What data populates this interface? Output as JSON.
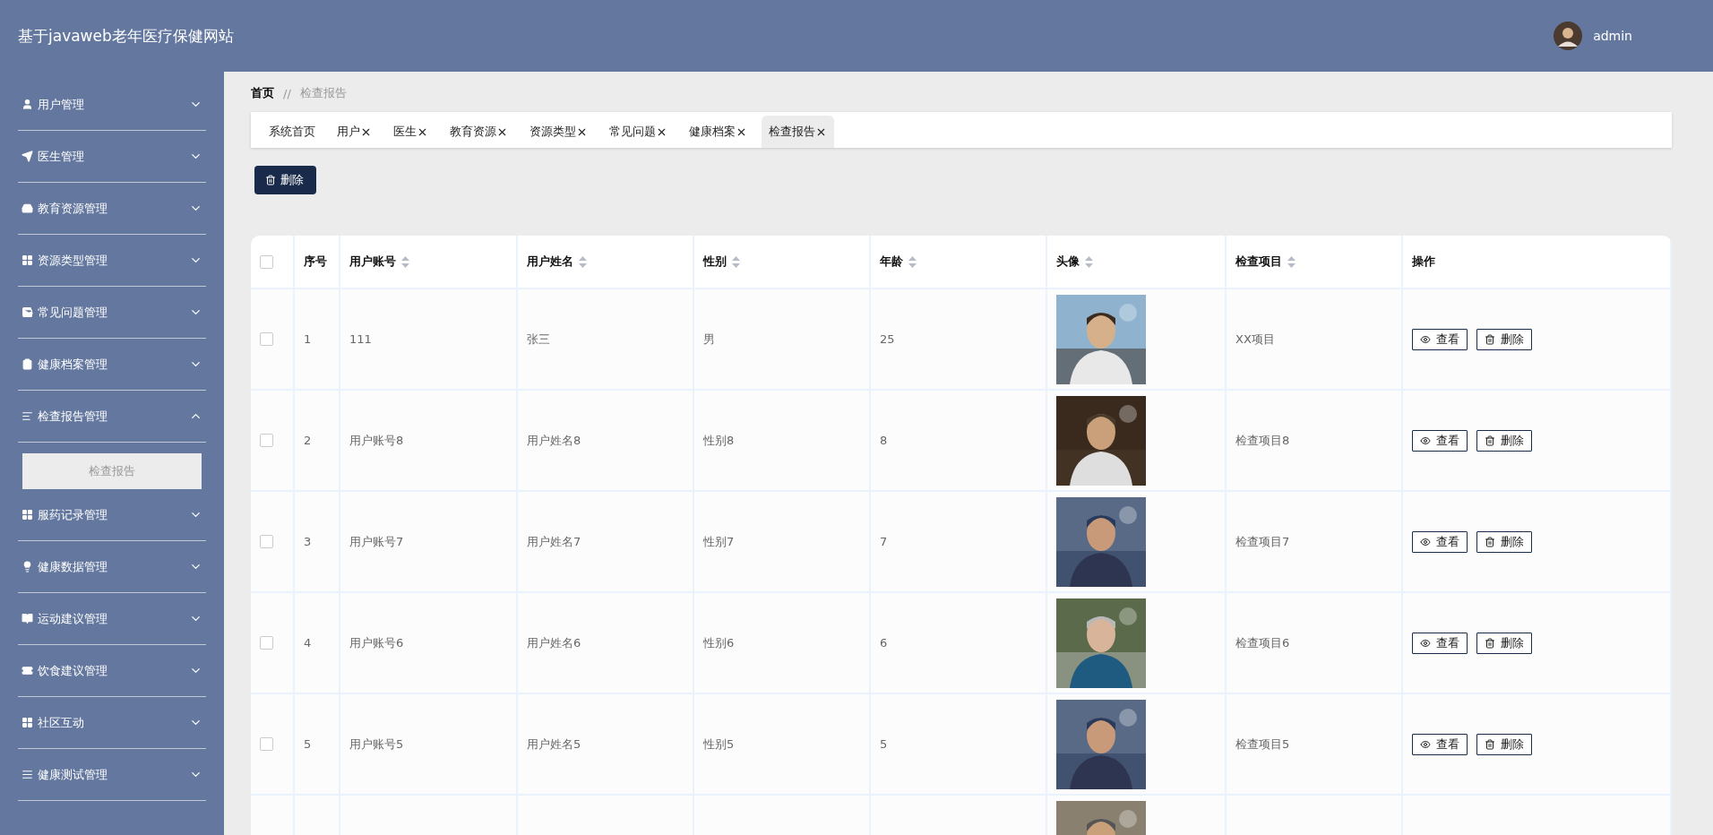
{
  "header": {
    "title": "基于javaweb老年医疗保健网站",
    "user": "admin"
  },
  "sidebar": {
    "items": [
      {
        "label": "用户管理",
        "expanded": false
      },
      {
        "label": "医生管理",
        "expanded": false
      },
      {
        "label": "教育资源管理",
        "expanded": false
      },
      {
        "label": "资源类型管理",
        "expanded": false
      },
      {
        "label": "常见问题管理",
        "expanded": false
      },
      {
        "label": "健康档案管理",
        "expanded": false
      },
      {
        "label": "检查报告管理",
        "expanded": true,
        "children": [
          {
            "label": "检查报告",
            "selected": true
          }
        ]
      },
      {
        "label": "服药记录管理",
        "expanded": false
      },
      {
        "label": "健康数据管理",
        "expanded": false
      },
      {
        "label": "运动建议管理",
        "expanded": false
      },
      {
        "label": "饮食建议管理",
        "expanded": false
      },
      {
        "label": "社区互动",
        "expanded": false
      },
      {
        "label": "健康测试管理",
        "expanded": false
      }
    ]
  },
  "breadcrumb": [
    "首页",
    "//",
    "检查报告"
  ],
  "tabs": [
    {
      "label": "系统首页",
      "closable": false,
      "selected": false
    },
    {
      "label": "用户",
      "closable": true,
      "selected": false
    },
    {
      "label": "医生",
      "closable": true,
      "selected": false
    },
    {
      "label": "教育资源",
      "closable": true,
      "selected": false
    },
    {
      "label": "资源类型",
      "closable": true,
      "selected": false
    },
    {
      "label": "常见问题",
      "closable": true,
      "selected": false
    },
    {
      "label": "健康档案",
      "closable": true,
      "selected": false
    },
    {
      "label": "检查报告",
      "closable": true,
      "selected": true
    }
  ],
  "toolbar": {
    "delete_button": "删除"
  },
  "table": {
    "select_all_checked": false,
    "columns": [
      {
        "label": "序号",
        "sortable": false
      },
      {
        "label": "用户账号",
        "sortable": true
      },
      {
        "label": "用户姓名",
        "sortable": true
      },
      {
        "label": "性别",
        "sortable": true
      },
      {
        "label": "年龄",
        "sortable": true
      },
      {
        "label": "头像",
        "sortable": true
      },
      {
        "label": "检查项目",
        "sortable": true
      },
      {
        "label": "操作",
        "sortable": false
      }
    ],
    "rows": [
      {
        "kind": "full",
        "checked": false,
        "index": "1",
        "account": "111",
        "name": "张三",
        "gender": "男",
        "age": "25",
        "item": "XX项目",
        "view": "查看",
        "delete": "删除"
      },
      {
        "kind": "full",
        "checked": false,
        "index": "2",
        "account": "用户账号8",
        "name": "用户姓名8",
        "gender": "性别8",
        "age": "8",
        "item": "检查项目8",
        "view": "查看",
        "delete": "删除"
      },
      {
        "kind": "full",
        "checked": false,
        "index": "3",
        "account": "用户账号7",
        "name": "用户姓名7",
        "gender": "性别7",
        "age": "7",
        "item": "检查项目7",
        "view": "查看",
        "delete": "删除"
      },
      {
        "kind": "full",
        "checked": false,
        "index": "4",
        "account": "用户账号6",
        "name": "用户姓名6",
        "gender": "性别6",
        "age": "6",
        "item": "检查项目6",
        "view": "查看",
        "delete": "删除"
      },
      {
        "kind": "full",
        "checked": false,
        "index": "5",
        "account": "用户账号5",
        "name": "用户姓名5",
        "gender": "性别5",
        "age": "5",
        "item": "检查项目5",
        "view": "查看",
        "delete": "删除"
      },
      {
        "kind": "partial"
      }
    ]
  }
}
